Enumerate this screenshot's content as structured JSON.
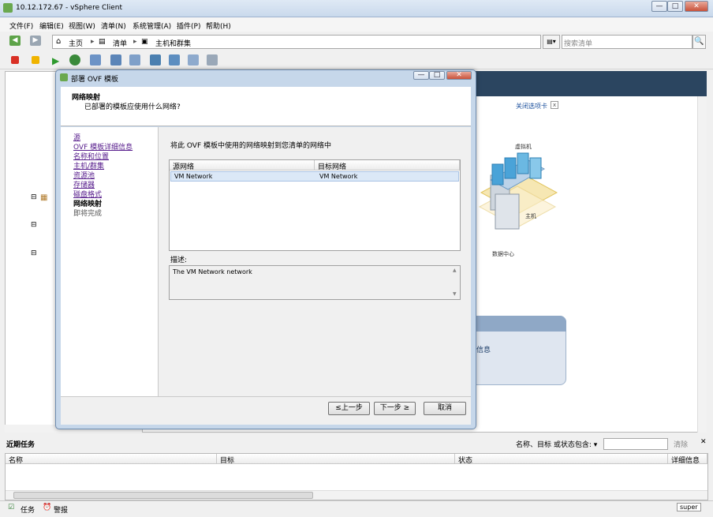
{
  "window": {
    "title": "10.12.172.67 - vSphere Client",
    "min": "—",
    "max": "□",
    "close": "✕"
  },
  "menu": [
    "文件(F)",
    "编辑(E)",
    "视图(W)",
    "清单(N)",
    "系统管理(A)",
    "插件(P)",
    "帮助(H)"
  ],
  "breadcrumb": {
    "home": "主页",
    "inventory": "清单",
    "hosts": "主机和群集"
  },
  "search": {
    "placeholder": "搜索清单",
    "button": "🔍"
  },
  "right": {
    "close_tab": "关闭选项卡",
    "close_x": "x",
    "vm_label": "虚拟机",
    "host_label": "主机",
    "dc_label": "数据中心",
    "info": "信息"
  },
  "dialog": {
    "title": "部署 OVF 模板",
    "header_title": "网络映射",
    "header_sub": "已部署的模板应使用什么网络?",
    "steps": [
      {
        "label": "源",
        "link": true
      },
      {
        "label": "OVF 模板详细信息",
        "link": true
      },
      {
        "label": "名称和位置",
        "link": true
      },
      {
        "label": "主机/群集",
        "link": true
      },
      {
        "label": "资源池",
        "link": true
      },
      {
        "label": "存储器",
        "link": true
      },
      {
        "label": "磁盘格式",
        "link": true
      },
      {
        "label": "网络映射",
        "link": false,
        "current": true
      },
      {
        "label": "即将完成",
        "link": false
      }
    ],
    "instruction": "将此 OVF 模板中使用的网络映射到您清单的网络中",
    "table": {
      "headers": [
        "源网络",
        "目标网络"
      ],
      "rows": [
        [
          "VM Network",
          "VM Network"
        ]
      ]
    },
    "desc_label": "描述:",
    "desc_text": "The VM Network network",
    "buttons": {
      "back": "≤上一步",
      "next": "下一步 ≥",
      "cancel": "取消"
    }
  },
  "tasks": {
    "title": "近期任务",
    "filter_label": "名称、目标 或状态包含: ▾",
    "clear": "清除",
    "close": "✕",
    "columns": [
      "名称",
      "目标",
      "状态",
      "详细信息"
    ]
  },
  "status": {
    "tasks": "任务",
    "alarms": "警报",
    "user": "super"
  },
  "colors": {
    "accent": "#2b4560",
    "link": "#551a8b",
    "selection": "#dbe8f7"
  }
}
